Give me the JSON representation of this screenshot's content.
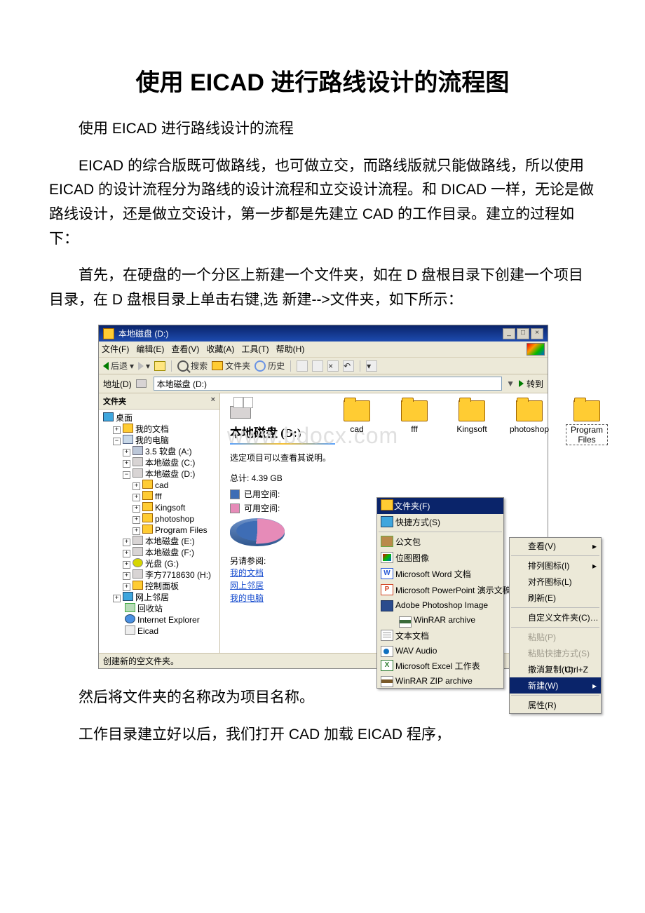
{
  "doc": {
    "h1": "使用 EICAD 进行路线设计的流程图",
    "p1": "使用 EICAD 进行路线设计的流程",
    "p2": "EICAD 的综合版既可做路线，也可做立交，而路线版就只能做路线，所以使用 EICAD 的设计流程分为路线的设计流程和立交设计流程。和 DICAD 一样，无论是做路线设计，还是做立交设计，第一步都是先建立 CAD 的工作目录。建立的过程如下：",
    "p3": "首先，在硬盘的一个分区上新建一个文件夹，如在 D 盘根目录下创建一个项目目录，在 D 盘根目录上单击右键,选 新建-->文件夹，如下所示：",
    "p4": "然后将文件夹的名称改为项目名称。",
    "p5": "工作目录建立好以后，我们打开 CAD 加载 EICAD 程序，"
  },
  "win": {
    "title": "本地磁盘 (D:)",
    "menus": {
      "file": "文件(F)",
      "edit": "编辑(E)",
      "view": "查看(V)",
      "fav": "收藏(A)",
      "tools": "工具(T)",
      "help": "帮助(H)"
    },
    "tb": {
      "back": "后退",
      "search": "搜索",
      "folders": "文件夹",
      "history": "历史"
    },
    "addr_label": "地址(D)",
    "addr_value": "本地磁盘 (D:)",
    "go": "转到",
    "tree_title": "文件夹",
    "tree": {
      "desktop": "桌面",
      "mydocs": "我的文档",
      "mypc": "我的电脑",
      "floppy": "3.5 软盘 (A:)",
      "c": "本地磁盘 (C:)",
      "d": "本地磁盘 (D:)",
      "d_children": [
        "cad",
        "fff",
        "Kingsoft",
        "photoshop",
        "Program Files"
      ],
      "e": "本地磁盘 (E:)",
      "f": "本地磁盘 (F:)",
      "g": "光盘 (G:)",
      "h": "李方7718630 (H:)",
      "ctrl": "控制面板",
      "net": "网上邻居",
      "bin": "回收站",
      "ie": "Internet Explorer",
      "eicad": "Eicad"
    },
    "content": {
      "drive_name": "本地磁盘 (D:)",
      "hint": "选定项目可以查看其说明。",
      "total": "总计: 4.39 GB",
      "used_label": "已用空间:",
      "free_label": "可用空间:",
      "seealso_title": "另请参阅:",
      "links": [
        "我的文档",
        "网上邻居",
        "我的电脑"
      ],
      "watermark": "www.bdocx.com"
    },
    "folders": [
      "cad",
      "fff",
      "Kingsoft",
      "photoshop",
      "Program Files"
    ],
    "submenu": {
      "header": "文件夹(F)",
      "items": [
        {
          "ic": "desk",
          "label": "快捷方式(S)"
        },
        {
          "sep": true
        },
        {
          "ic": "brief",
          "label": "公文包"
        },
        {
          "ic": "bmp",
          "label": "位图图像"
        },
        {
          "ic": "word",
          "label": "Microsoft Word 文档"
        },
        {
          "ic": "ppt",
          "label": "Microsoft PowerPoint 演示文稿"
        },
        {
          "ic": "ps",
          "label": "Adobe Photoshop Image"
        },
        {
          "ic": "rar",
          "label": "WinRAR archive"
        },
        {
          "ic": "txt",
          "label": "文本文档"
        },
        {
          "ic": "wav",
          "label": "WAV Audio"
        },
        {
          "ic": "xls",
          "label": "Microsoft Excel 工作表"
        },
        {
          "ic": "zip",
          "label": "WinRAR ZIP archive"
        }
      ]
    },
    "ctxmenu": [
      {
        "label": "查看(V)",
        "arrow": true
      },
      {
        "sep": true
      },
      {
        "label": "排列图标(I)",
        "arrow": true
      },
      {
        "label": "对齐图标(L)"
      },
      {
        "label": "刷新(E)"
      },
      {
        "sep": true
      },
      {
        "label": "自定义文件夹(C)…"
      },
      {
        "sep": true
      },
      {
        "label": "粘贴(P)",
        "disabled": true
      },
      {
        "label": "粘贴快捷方式(S)",
        "disabled": true
      },
      {
        "label": "撤消复制(U)",
        "kbd": "Ctrl+Z"
      },
      {
        "sel": true,
        "label": "新建(W)",
        "arrow": true
      },
      {
        "sep": true
      },
      {
        "label": "属性(R)"
      }
    ],
    "status": "创建新的空文件夹。"
  }
}
